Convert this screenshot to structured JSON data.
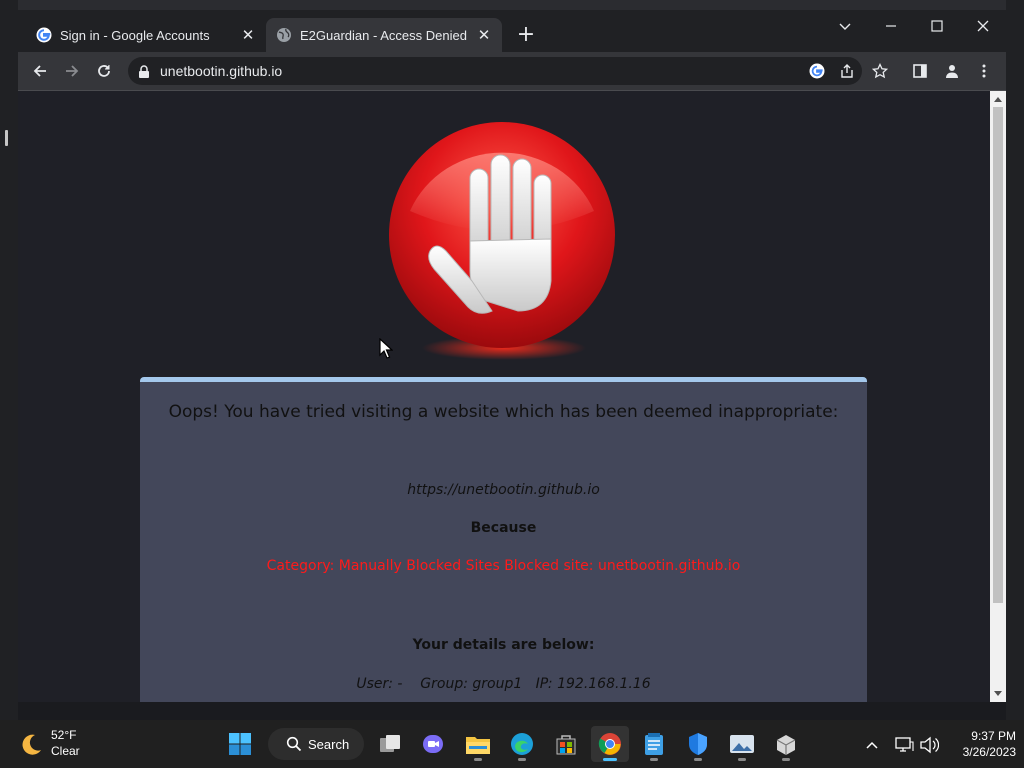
{
  "browser": {
    "tabs": [
      {
        "title": "Sign in - Google Accounts",
        "active": false,
        "favicon": "google-g-icon"
      },
      {
        "title": "E2Guardian - Access Denied",
        "active": true,
        "favicon": "globe-icon"
      }
    ],
    "address": "unetbootin.github.io"
  },
  "page": {
    "headline": "Oops! You have tried visiting a website which has been deemed inappropriate:",
    "blocked_url": "https://unetbootin.github.io",
    "because_label": "Because",
    "reason": "Category: Manually Blocked Sites   Blocked site: unetbootin.github.io",
    "details_label": "Your details are below:",
    "user_line": "User: -    Group: group1   IP: 192.168.1.16"
  },
  "taskbar": {
    "weather": {
      "temp": "52°F",
      "condition": "Clear"
    },
    "search_label": "Search",
    "time": "9:37 PM",
    "date": "3/26/2023"
  },
  "colors": {
    "blocked_reason": "#ff1a1a",
    "panel_bg": "#43475a",
    "panel_top_border": "#a4c8ec",
    "page_bg": "#1f2027"
  }
}
